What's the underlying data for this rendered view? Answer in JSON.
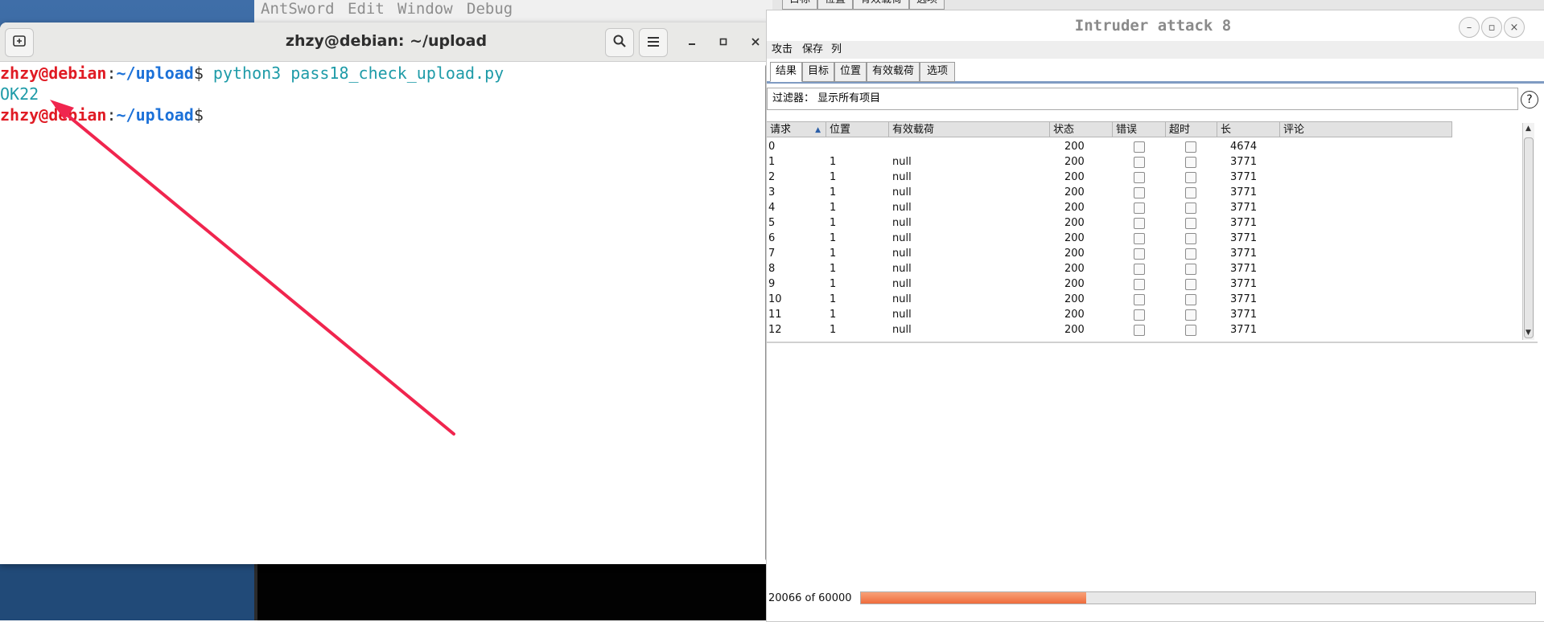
{
  "desktop": {
    "antsword_menu": [
      "AntSword",
      "Edit",
      "Window",
      "Debug"
    ],
    "back_tabs": [
      "目标",
      "位置",
      "有效载荷",
      "选项"
    ]
  },
  "terminal": {
    "title": "zhzy@debian: ~/upload",
    "icons": {
      "new_tab": "new-tab-icon",
      "search": "search-icon",
      "menu": "hamburger-menu-icon"
    },
    "lines": [
      {
        "user": "zhzy@debian",
        "path": "~/upload",
        "sep": ":",
        "dollar": "$",
        "cmd": " python3 pass18_check_upload.py"
      },
      {
        "output": "OK22"
      },
      {
        "user": "zhzy@debian",
        "path": "~/upload",
        "sep": ":",
        "dollar": "$",
        "cmd": ""
      }
    ],
    "colors": {
      "user": "#e01b24",
      "path": "#1c71d8",
      "cmd": "#1e9ba8"
    }
  },
  "intruder": {
    "title": "Intruder attack 8",
    "menu": [
      "攻击",
      "保存",
      "列"
    ],
    "tabs": [
      "结果",
      "目标",
      "位置",
      "有效载荷",
      "选项"
    ],
    "active_tab": "结果",
    "filter": "过滤器： 显示所有项目",
    "help": "?",
    "columns": [
      "请求",
      "位置",
      "有效载荷",
      "状态",
      "错误",
      "超时",
      "长",
      "评论"
    ],
    "rows": [
      {
        "req": "0",
        "pos": "",
        "payload": "",
        "status": "200",
        "len": "4674"
      },
      {
        "req": "1",
        "pos": "1",
        "payload": "null",
        "status": "200",
        "len": "3771"
      },
      {
        "req": "2",
        "pos": "1",
        "payload": "null",
        "status": "200",
        "len": "3771"
      },
      {
        "req": "3",
        "pos": "1",
        "payload": "null",
        "status": "200",
        "len": "3771"
      },
      {
        "req": "4",
        "pos": "1",
        "payload": "null",
        "status": "200",
        "len": "3771"
      },
      {
        "req": "5",
        "pos": "1",
        "payload": "null",
        "status": "200",
        "len": "3771"
      },
      {
        "req": "6",
        "pos": "1",
        "payload": "null",
        "status": "200",
        "len": "3771"
      },
      {
        "req": "7",
        "pos": "1",
        "payload": "null",
        "status": "200",
        "len": "3771"
      },
      {
        "req": "8",
        "pos": "1",
        "payload": "null",
        "status": "200",
        "len": "3771"
      },
      {
        "req": "9",
        "pos": "1",
        "payload": "null",
        "status": "200",
        "len": "3771"
      },
      {
        "req": "10",
        "pos": "1",
        "payload": "null",
        "status": "200",
        "len": "3771"
      },
      {
        "req": "11",
        "pos": "1",
        "payload": "null",
        "status": "200",
        "len": "3771"
      },
      {
        "req": "12",
        "pos": "1",
        "payload": "null",
        "status": "200",
        "len": "3771"
      }
    ],
    "progress": {
      "label": "20066 of 60000",
      "done": 20066,
      "total": 60000
    },
    "accent": "#ef6c3d"
  },
  "annotation": {
    "type": "arrow",
    "color": "#f0254e",
    "points_to": "OK22"
  }
}
